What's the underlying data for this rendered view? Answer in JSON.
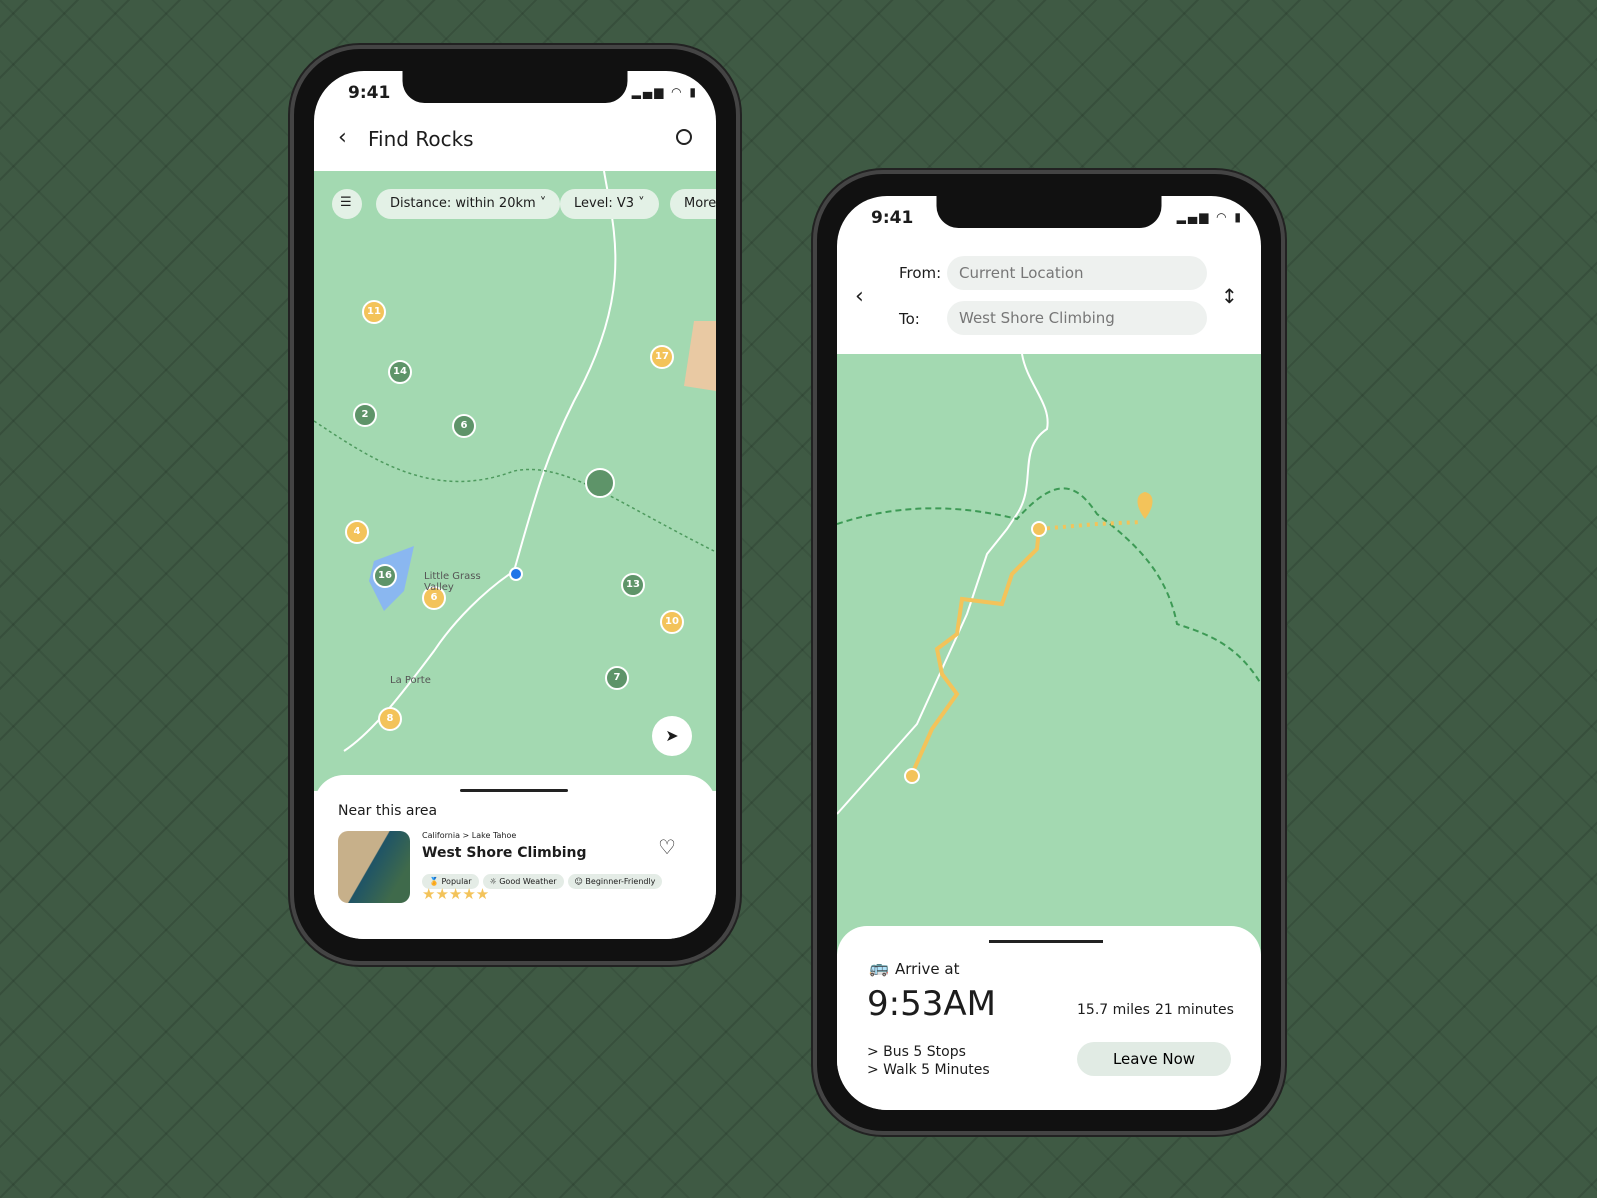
{
  "left": {
    "status_time": "9:41",
    "title": "Find Rocks",
    "filters": [
      "Distance: within 20km",
      "Level: V3",
      "More"
    ],
    "markers": [
      "11",
      "14",
      "2",
      "6",
      "17",
      "",
      "4",
      "16",
      "6",
      "13",
      "10",
      "7",
      "8"
    ],
    "map_labels": [
      "Little Grass Valley",
      "La Porte"
    ],
    "sheet": {
      "heading": "Near this area",
      "breadcrumb": "California > Lake Tahoe",
      "name": "West Shore Climbing",
      "tags": [
        "Popular",
        "Good Weather",
        "Beginner-Friendly"
      ],
      "rating": 5,
      "stars": "★★★★★"
    }
  },
  "right": {
    "status_time": "9:41",
    "from_label": "From:",
    "from_value": "Current Location",
    "to_label": "To:",
    "to_value": "West Shore Climbing",
    "arrive_label": "Arrive at",
    "arrive_time": "9:53AM",
    "distance": "15.7 miles",
    "duration": "21 minutes",
    "steps": [
      "> Bus 5 Stops",
      "> Walk 5 Minutes"
    ],
    "leave_button": "Leave Now"
  },
  "colors": {
    "accent": "#f3c35a",
    "green_marker": "#5e9469",
    "map": "#a3d9b1",
    "user_dot": "#1f74e8"
  }
}
